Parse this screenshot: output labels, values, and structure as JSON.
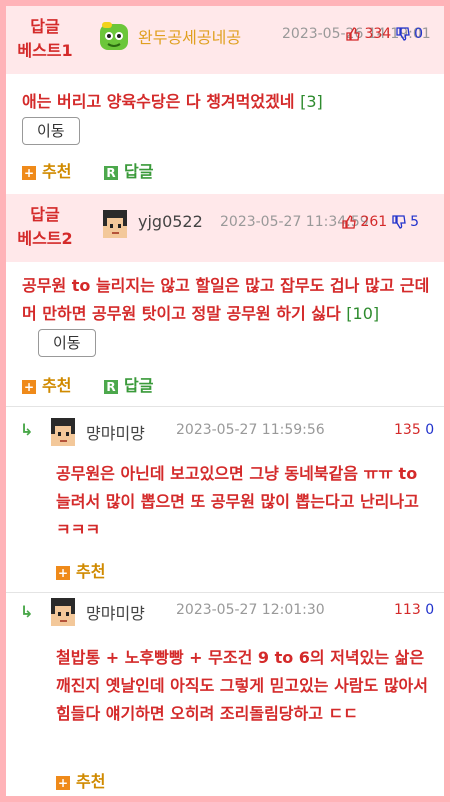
{
  "comments": [
    {
      "best_line1": "답글",
      "best_line2": "베스트1",
      "avatar": "green-face-icon",
      "nickname": "완두공세공네공",
      "date": "2023-05-26 14:19:01",
      "up": "334",
      "down": "0",
      "text": "애는 버리고 양육수당은 다 챙겨먹었겠네",
      "replies": "[3]",
      "move": "이동",
      "recommend": "추천",
      "reply": "답글"
    },
    {
      "best_line1": "답글",
      "best_line2": "베스트2",
      "avatar": "pixel-face-icon",
      "nickname": "yjg0522",
      "date": "2023-05-27 11:34:59",
      "up": "261",
      "down": "5",
      "text": "공무원 to 늘리지는 않고 할일은 많고 잡무도 겁나 많고 근데 머 만하면 공무원 탓이고 정말 공무원 하기 싫다",
      "replies": "[10]",
      "move": "이동",
      "recommend": "추천",
      "reply": "답글"
    }
  ],
  "sub_replies": [
    {
      "nickname": "먕먀미먕",
      "date": "2023-05-27 11:59:56",
      "up": "135",
      "down": "0",
      "text": "공무원은 아닌데 보고있으면 그냥 동네북같음 ㅠㅠ to늘려서 많이 뽑으면 또 공무원 많이 뽑는다고 난리나고ㅋㅋㅋ",
      "recommend": "추천"
    },
    {
      "nickname": "먕먀미먕",
      "date": "2023-05-27 12:01:30",
      "up": "113",
      "down": "0",
      "text": "철밥통 + 노후빵빵 + 무조건 9 to 6의 저녁있는 삶은 깨진지 옛날인데 아직도 그렇게 믿고있는 사람도 많아서 힘들다 얘기하면 오히려 조리돌림당하고 ㄷㄷ",
      "recommend": "추천"
    }
  ],
  "colors": {
    "accent": "#d42a2a",
    "best_bg": "#ffe8ea",
    "frame": "#ffb3b8",
    "down_vote": "#2233cc",
    "reply_count": "#2e8b2e"
  }
}
